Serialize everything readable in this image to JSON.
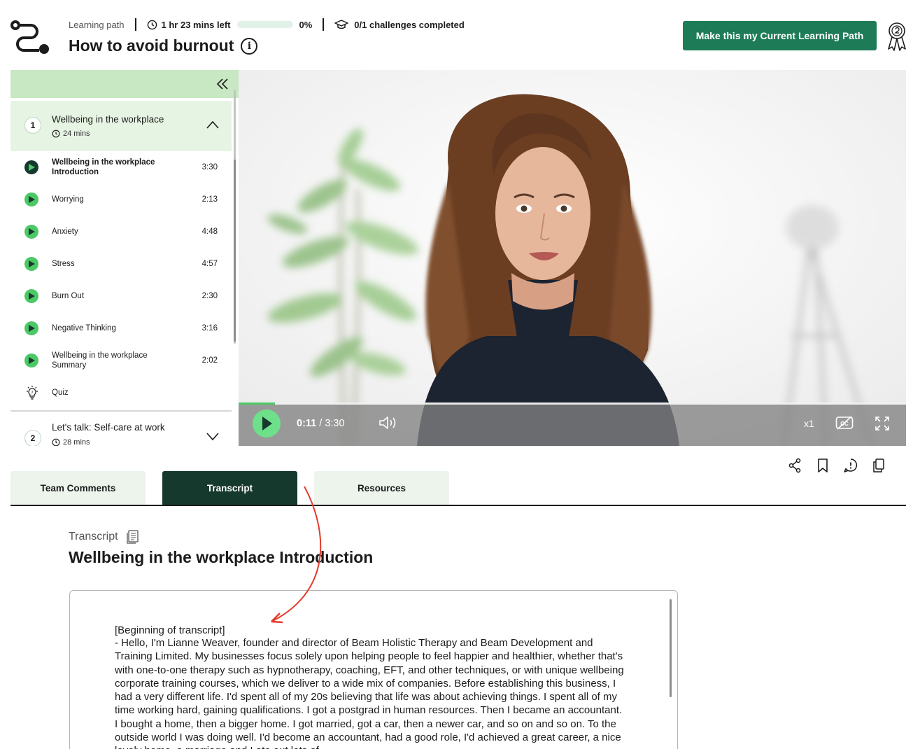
{
  "header": {
    "breadcrumb": "Learning path",
    "time_left": "1 hr 23 mins left",
    "progress_percent": 0,
    "progress_label": "0%",
    "challenges": "0/1 challenges completed",
    "title": "How to avoid burnout",
    "cta_label": "Make this my Current Learning Path"
  },
  "sidebar": {
    "modules": [
      {
        "number": "1",
        "title": "Wellbeing in the workplace",
        "duration": "24 mins",
        "expanded": true,
        "lessons": [
          {
            "title": "Wellbeing in the workplace Introduction",
            "duration": "3:30",
            "current": true
          },
          {
            "title": "Worrying",
            "duration": "2:13"
          },
          {
            "title": "Anxiety",
            "duration": "4:48"
          },
          {
            "title": "Stress",
            "duration": "4:57"
          },
          {
            "title": "Burn Out",
            "duration": "2:30"
          },
          {
            "title": "Negative Thinking",
            "duration": "3:16"
          },
          {
            "title": "Wellbeing in the workplace Summary",
            "duration": "2:02"
          },
          {
            "title": "Quiz",
            "duration": ""
          }
        ]
      },
      {
        "number": "2",
        "title": "Let's talk: Self-care at work",
        "duration": "28 mins",
        "expanded": false
      }
    ]
  },
  "video": {
    "current_time": "0:11",
    "separator": "/",
    "total_time": "3:30",
    "played_fraction": 0.055,
    "speed": "x1"
  },
  "tabs": [
    {
      "label": "Team Comments",
      "active": false
    },
    {
      "label": "Transcript",
      "active": true
    },
    {
      "label": "Resources",
      "active": false
    }
  ],
  "transcript": {
    "label": "Transcript",
    "title": "Wellbeing in the workplace Introduction",
    "heading": "[Beginning of transcript]",
    "body": "- Hello, I'm Lianne Weaver, founder and director of Beam Holistic Therapy and Beam Development and Training Limited. My businesses focus solely upon helping people to feel happier and healthier, whether that's with one-to-one therapy such as hypnotherapy, coaching, EFT, and other techniques, or with unique wellbeing corporate training courses, which we deliver to a wide mix of companies. Before establishing this business, I had a very different life. I'd spent all of my 20s believing that life was about achieving things. I spent all of my time working hard, gaining qualifications. I got a postgrad in human resources. Then I became an accountant. I bought a home, then a bigger home. I got married, got a car, then a newer car, and so on and so on. To the outside world I was doing well. I'd become an accountant, had a good role, I'd achieved a great career, a nice lovely home, a marriage and I ate out lots of"
  },
  "colors": {
    "brand_green": "#1e7b57",
    "dark_green": "#16392d",
    "accent_green": "#4cc866",
    "light_green": "#c8e8c3"
  }
}
